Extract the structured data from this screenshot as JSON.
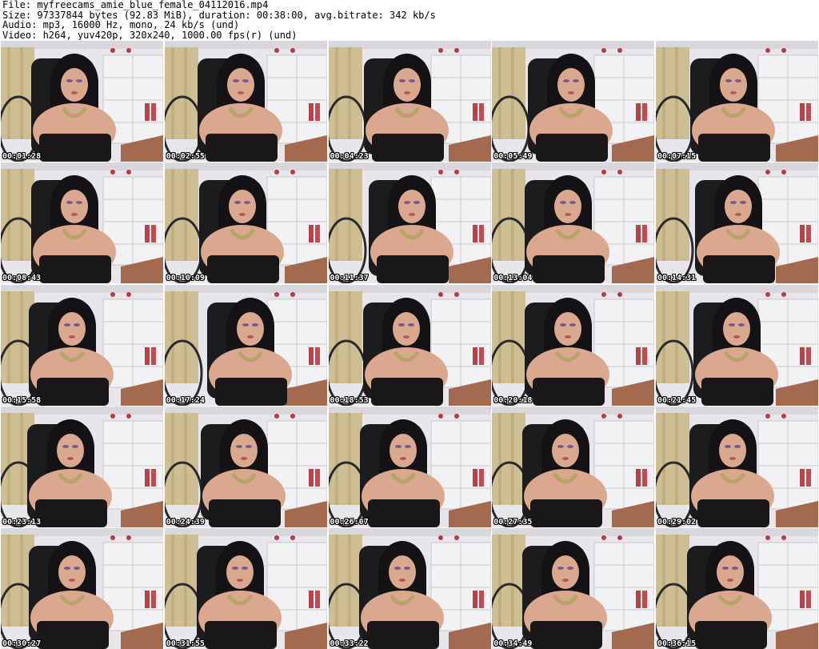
{
  "info": {
    "file": "File: myfreecams_amie_blue_female_04112016.mp4",
    "size": "Size: 97337844 bytes (92.83 MiB), duration: 00:38:00, avg.bitrate: 342 kb/s",
    "audio": "Audio: mp3, 16000 Hz, mono, 24 kb/s (und)",
    "video": "Video: h264, yuv420p, 320x240, 1000.00 fps(r) (und)"
  },
  "thumbnails": [
    {
      "timestamp": "00:01:28",
      "offset": 0.0
    },
    {
      "timestamp": "00:02:55",
      "offset": 0.05
    },
    {
      "timestamp": "00:04:23",
      "offset": 0.1
    },
    {
      "timestamp": "00:05:49",
      "offset": 0.12
    },
    {
      "timestamp": "00:07:15",
      "offset": 0.08
    },
    {
      "timestamp": "00:08:43",
      "offset": 0.0
    },
    {
      "timestamp": "00:10:09",
      "offset": 0.08
    },
    {
      "timestamp": "00:11:37",
      "offset": 0.2
    },
    {
      "timestamp": "00:13:04",
      "offset": 0.05
    },
    {
      "timestamp": "00:14:31",
      "offset": 0.18
    },
    {
      "timestamp": "00:15:58",
      "offset": -0.05
    },
    {
      "timestamp": "00:17:24",
      "offset": 0.25
    },
    {
      "timestamp": "00:18:53",
      "offset": 0.08
    },
    {
      "timestamp": "00:20:18",
      "offset": 0.05
    },
    {
      "timestamp": "00:21:45",
      "offset": 0.15
    },
    {
      "timestamp": "00:23:13",
      "offset": -0.08
    },
    {
      "timestamp": "00:24:39",
      "offset": 0.12
    },
    {
      "timestamp": "00:26:07",
      "offset": 0.02
    },
    {
      "timestamp": "00:27:35",
      "offset": 0.0
    },
    {
      "timestamp": "00:29:02",
      "offset": 0.06
    },
    {
      "timestamp": "00:30:27",
      "offset": -0.05
    },
    {
      "timestamp": "00:31:55",
      "offset": 0.04
    },
    {
      "timestamp": "00:33:22",
      "offset": 0.0
    },
    {
      "timestamp": "00:34:49",
      "offset": 0.0
    },
    {
      "timestamp": "00:36:15",
      "offset": 0.02
    }
  ],
  "colors": {
    "background": "#ffffff",
    "text": "#000000",
    "timestamp_text": "#ffffff",
    "timestamp_outline": "#000000",
    "wall": "#e8e6ea",
    "curtain": "#cdbf93",
    "chair": "#1c1c1e",
    "hair": "#141214",
    "skin": "#d9a88f",
    "dress": "#1a1718",
    "shelf": "#f2f2f4",
    "floor": "#a46a50",
    "necklace": "#b9a36a"
  }
}
